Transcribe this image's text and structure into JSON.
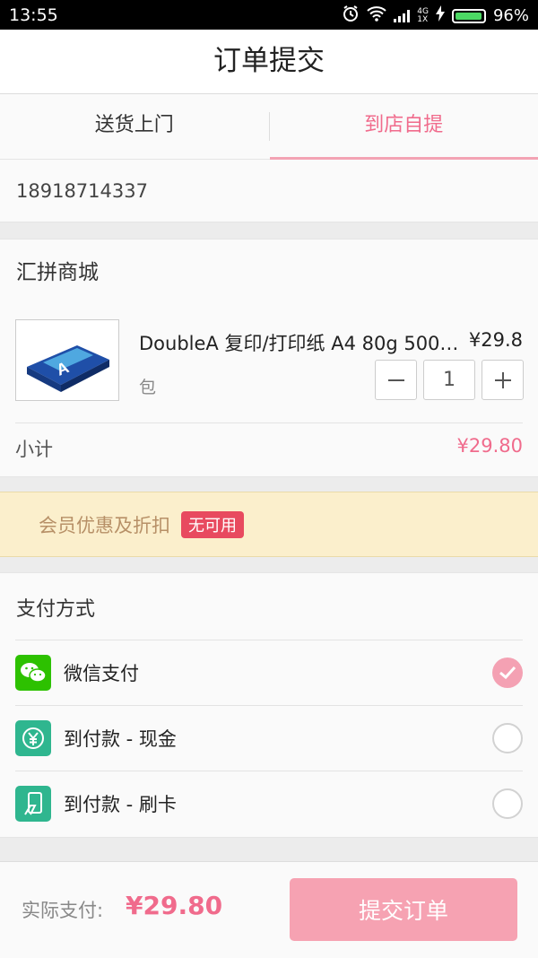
{
  "status_bar": {
    "time": "13:55",
    "network_top": "4G",
    "network_bottom": "1X",
    "battery_percent": "96%",
    "battery_level": 0.96
  },
  "header": {
    "title": "订单提交"
  },
  "delivery_tabs": [
    {
      "label": "送货上门",
      "active": false
    },
    {
      "label": "到店自提",
      "active": true
    }
  ],
  "contact": {
    "phone": "18918714337"
  },
  "store": {
    "name": "汇拼商城",
    "product": {
      "title": "DoubleA 复印/打印纸 A4 80g 500…",
      "price": "¥29.8",
      "subtitle": "包",
      "quantity": "1",
      "image_brand": "Double A"
    },
    "subtotal_label": "小计",
    "subtotal_value": "¥29.80"
  },
  "member": {
    "label": "会员优惠及折扣",
    "badge": "无可用"
  },
  "payment": {
    "title": "支付方式",
    "methods": [
      {
        "label": "微信支付",
        "icon": "wechat-icon",
        "selected": true
      },
      {
        "label": "到付款 - 现金",
        "icon": "yuan-cash-icon",
        "selected": false
      },
      {
        "label": "到付款 - 刷卡",
        "icon": "card-swipe-icon",
        "selected": false
      }
    ]
  },
  "footer": {
    "total_label": "实际支付:",
    "total_value": "¥29.80",
    "submit_label": "提交订单"
  },
  "colors": {
    "accent": "#f06b8c",
    "submit_bg": "#f6a2b2",
    "badge": "#e84a5f",
    "wechat": "#2dc100",
    "teal": "#2fb68f"
  }
}
